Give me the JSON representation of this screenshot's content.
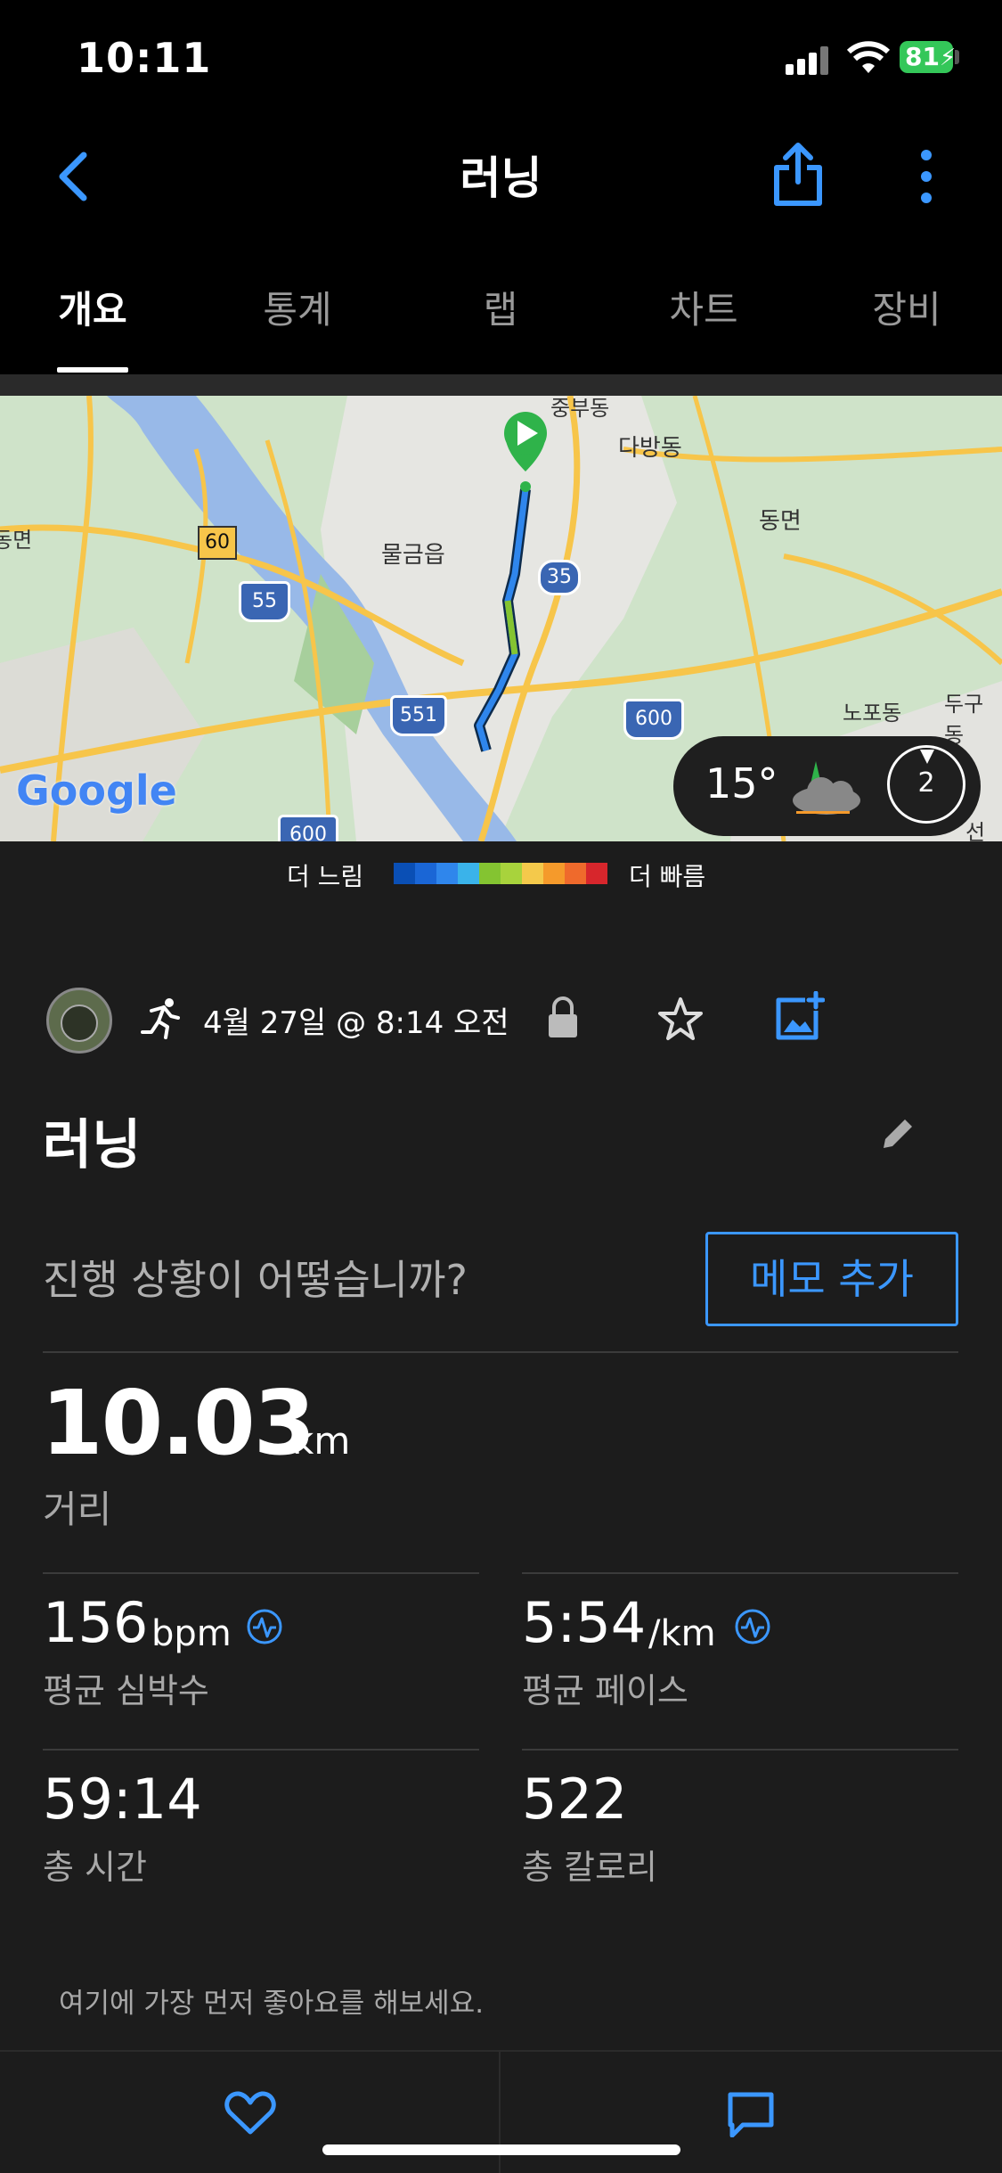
{
  "status_bar": {
    "time": "10:11",
    "battery": "81"
  },
  "header": {
    "title": "러닝"
  },
  "tabs": [
    "개요",
    "통계",
    "랩",
    "차트",
    "장비"
  ],
  "map": {
    "labels": [
      "중부동",
      "다방동",
      "동면",
      "물금읍",
      "노포동",
      "두구동",
      "선동",
      "동면"
    ],
    "road_signs": [
      "60",
      "55",
      "35",
      "551",
      "600",
      "600"
    ],
    "attribution": "Google",
    "weather": {
      "temperature": "15°",
      "wind": "2"
    }
  },
  "legend": {
    "slow_label": "더 느림",
    "fast_label": "더 빠름",
    "colors": [
      "#0a4fb5",
      "#1a66d6",
      "#2f86ec",
      "#3ab3ea",
      "#84c431",
      "#a8d33c",
      "#f4c94b",
      "#f59a2b",
      "#ef6a2c",
      "#d7262c"
    ]
  },
  "activity": {
    "datetime": "4월 27일 @ 8:14 오전",
    "name": "러닝",
    "prompt": "진행 상황이 어떻습니까?",
    "memo_button": "메모 추가"
  },
  "stats": {
    "distance": {
      "value": "10.03",
      "unit": "km",
      "label": "거리"
    },
    "heart_rate": {
      "value": "156",
      "unit": "bpm",
      "label": "평균 심박수"
    },
    "pace": {
      "value": "5:54",
      "unit": "/km",
      "label": "평균 페이스"
    },
    "time": {
      "value": "59:14",
      "label": "총 시간"
    },
    "calories": {
      "value": "522",
      "label": "총 칼로리"
    }
  },
  "like_prompt": "여기에 가장 먼저 좋아요를 해보세요.",
  "colors": {
    "accent": "#3b97ff",
    "background": "#1c1c1c"
  }
}
